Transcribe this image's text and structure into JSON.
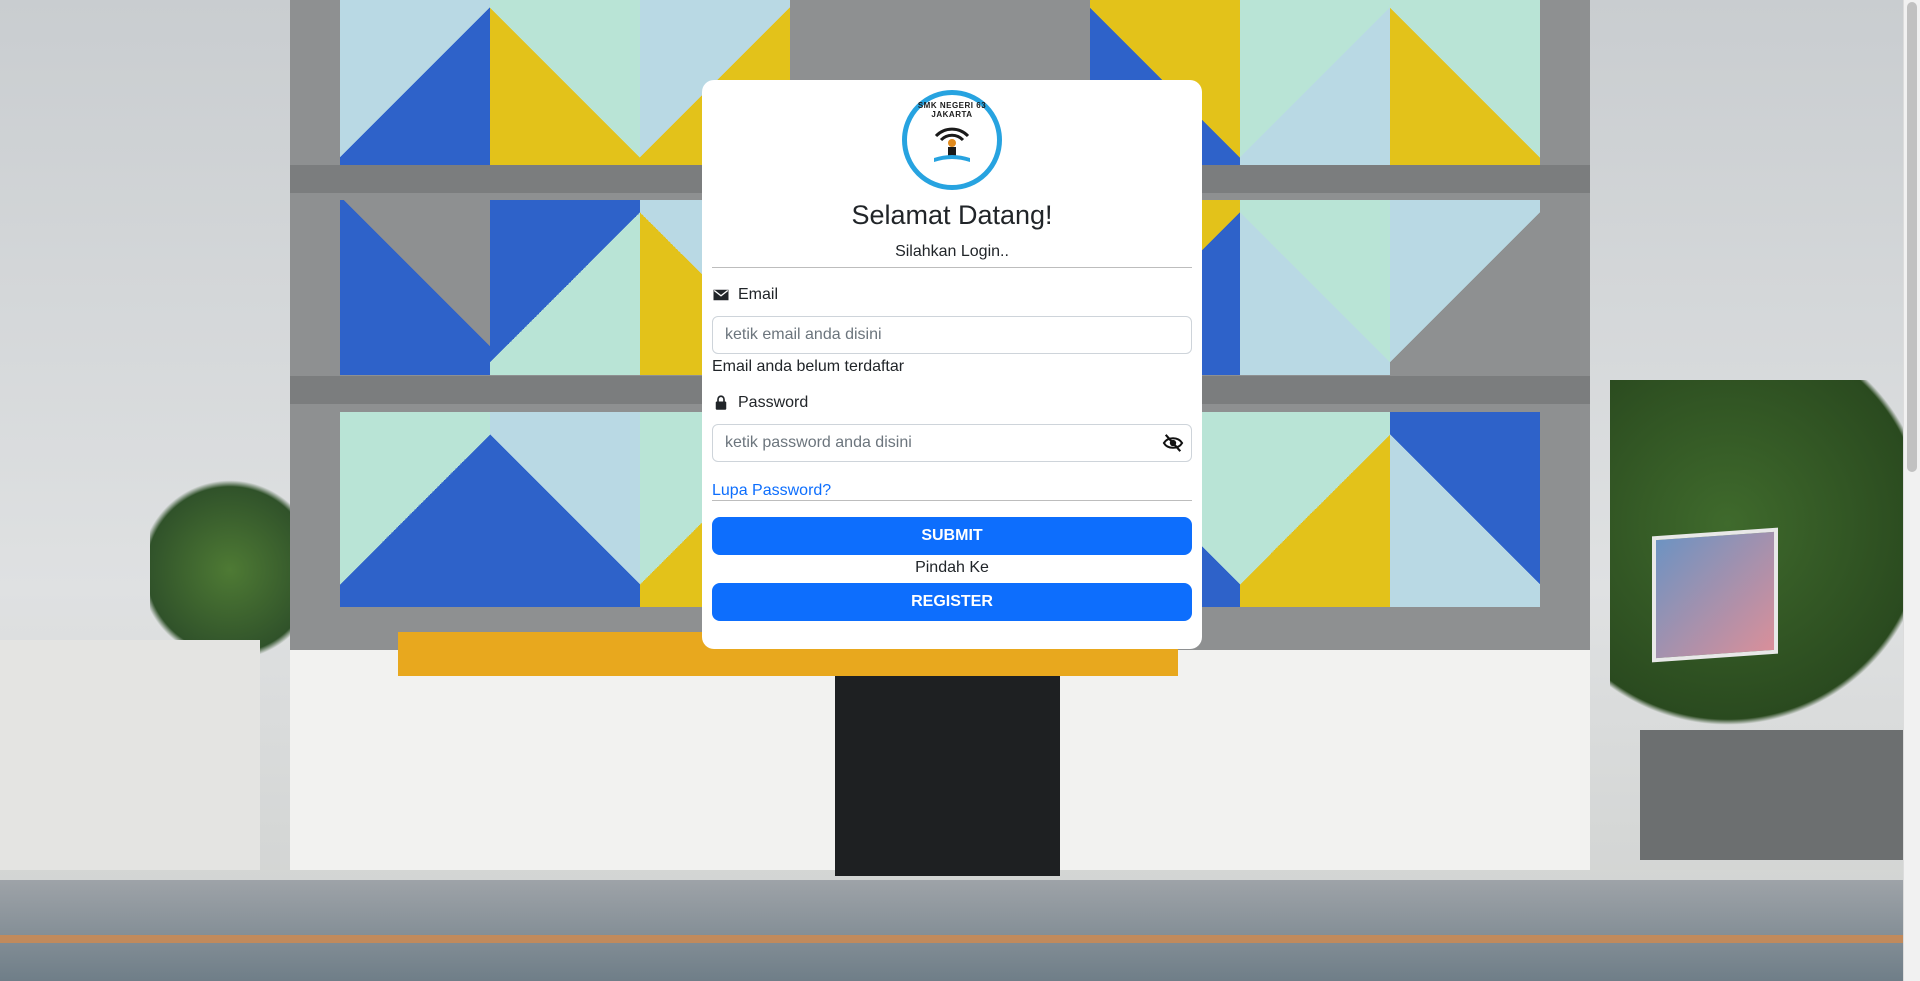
{
  "header": {
    "title": "Selamat Datang!",
    "subtitle": "Silahkan Login.."
  },
  "logo": {
    "wordmark": "SMK NEGERI 63 JAKARTA"
  },
  "form": {
    "email": {
      "label": "Email",
      "icon": "envelope-icon",
      "placeholder": "ketik email anda disini",
      "value": "",
      "error": "Email anda belum terdaftar"
    },
    "password": {
      "label": "Password",
      "icon": "lock-icon",
      "placeholder": "ketik password anda disini",
      "value": "",
      "toggle_icon": "eye-slash-icon"
    },
    "forgot_label": "Lupa Password?",
    "submit_label": "SUBMIT",
    "switch_text": "Pindah Ke",
    "register_label": "REGISTER"
  },
  "colors": {
    "primary": "#0d6efd",
    "logo_ring": "#27a3e0"
  }
}
